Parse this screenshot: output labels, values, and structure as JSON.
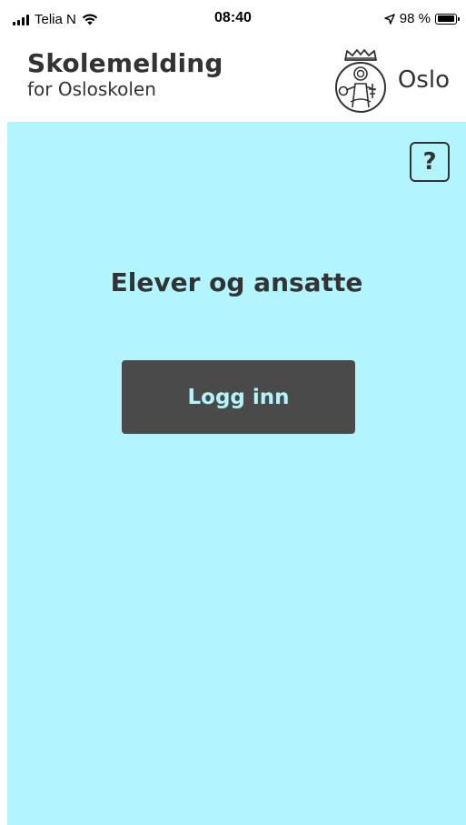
{
  "status_bar": {
    "carrier": "Telia N",
    "time": "08:40",
    "battery_percent": "98 %",
    "battery_level": 0.98,
    "location_icon": "location-arrow-icon",
    "wifi_icon": "wifi-icon",
    "signal_icon": "cellular-signal-icon"
  },
  "header": {
    "app_title": "Skolemelding",
    "app_subtitle": "for Osloskolen",
    "city_logo_icon": "oslo-seal-icon",
    "city_name": "Oslo"
  },
  "main": {
    "help_label": "?",
    "heading": "Elever og ansatte",
    "login_label": "Logg inn"
  },
  "colors": {
    "background": "#b3f5ff",
    "button": "#4a4a4a",
    "button_text": "#b3f5ff",
    "text": "#333333"
  }
}
